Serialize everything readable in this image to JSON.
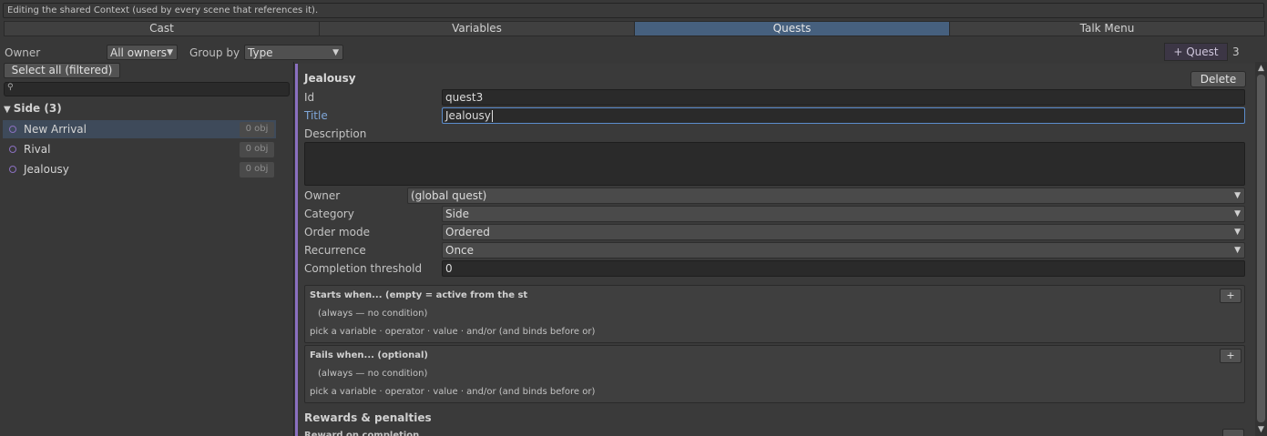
{
  "banner": "Editing the shared Context (used by every scene that references it).",
  "tabs": [
    {
      "label": "Cast",
      "active": false
    },
    {
      "label": "Variables",
      "active": false
    },
    {
      "label": "Quests",
      "active": true
    },
    {
      "label": "Talk Menu",
      "active": false
    }
  ],
  "filters": {
    "owner_label": "Owner",
    "owner_value": "All owners",
    "group_label": "Group by",
    "group_value": "Type",
    "add_quest_label": "+ Quest",
    "quest_count": "3"
  },
  "list": {
    "select_all_label": "Select all (filtered)",
    "search_value": "",
    "group_header": "Side (3)",
    "items": [
      {
        "name": "New Arrival",
        "badge": "0 obj",
        "selected": true
      },
      {
        "name": "Rival",
        "badge": "0 obj",
        "selected": false
      },
      {
        "name": "Jealousy",
        "badge": "0 obj",
        "selected": false
      }
    ]
  },
  "detail": {
    "quest_name": "Jealousy",
    "delete_label": "Delete",
    "id_label": "Id",
    "id_value": "quest3",
    "title_label": "Title",
    "title_value": "Jealousy",
    "description_label": "Description",
    "description_value": "",
    "owner_label": "Owner",
    "owner_value": "(global quest)",
    "category_label": "Category",
    "category_value": "Side",
    "order_label": "Order mode",
    "order_value": "Ordered",
    "recurrence_label": "Recurrence",
    "recurrence_value": "Once",
    "threshold_label": "Completion threshold",
    "threshold_value": "0",
    "starts": {
      "title": "Starts when... (empty = active from the st",
      "always": "(always — no condition)",
      "hint": "pick a variable · operator · value · and/or  (and binds before or)",
      "plus": "+"
    },
    "fails": {
      "title": "Fails when... (optional)",
      "always": "(always — no condition)",
      "hint": "pick a variable · operator · value · and/or  (and binds before or)",
      "plus": "+"
    },
    "rewards_label": "Rewards & penalties",
    "reward_sub_label": "Reward on completion"
  },
  "colors": {
    "accent": "#8a70c0",
    "active_tab": "#46607e",
    "focus": "#5b8ccc"
  }
}
